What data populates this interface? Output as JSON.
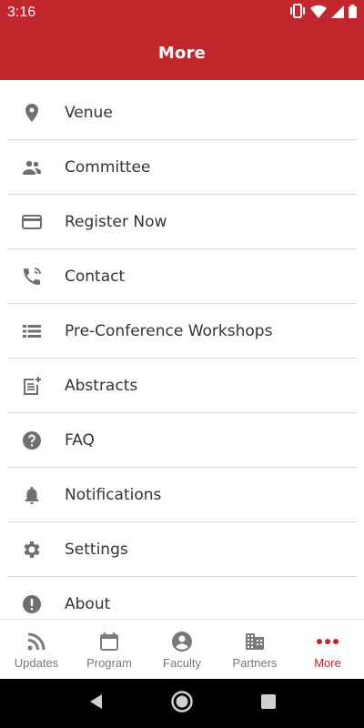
{
  "status_bar": {
    "time": "3:16",
    "icons": [
      "vibrate-icon",
      "wifi-icon",
      "signal-icon",
      "battery-icon"
    ]
  },
  "app_bar": {
    "title": "More"
  },
  "menu": {
    "items": [
      {
        "label": "Venue",
        "icon": "location-pin-icon"
      },
      {
        "label": "Committee",
        "icon": "people-icon"
      },
      {
        "label": "Register Now",
        "icon": "credit-card-icon"
      },
      {
        "label": "Contact",
        "icon": "phone-icon"
      },
      {
        "label": "Pre-Conference Workshops",
        "icon": "list-icon"
      },
      {
        "label": "Abstracts",
        "icon": "note-add-icon"
      },
      {
        "label": "FAQ",
        "icon": "help-icon"
      },
      {
        "label": "Notifications",
        "icon": "bell-icon"
      },
      {
        "label": "Settings",
        "icon": "gear-icon"
      },
      {
        "label": "About",
        "icon": "info-icon"
      }
    ]
  },
  "bottom_nav": {
    "tabs": [
      {
        "label": "Updates",
        "icon": "rss-icon"
      },
      {
        "label": "Program",
        "icon": "calendar-icon"
      },
      {
        "label": "Faculty",
        "icon": "account-icon"
      },
      {
        "label": "Partners",
        "icon": "building-icon"
      },
      {
        "label": "More",
        "icon": "more-dots-icon",
        "active": true
      }
    ]
  },
  "colors": {
    "brand": "#c1272d",
    "icon_gray": "#6f6f6f",
    "tab_inactive": "#777777"
  }
}
